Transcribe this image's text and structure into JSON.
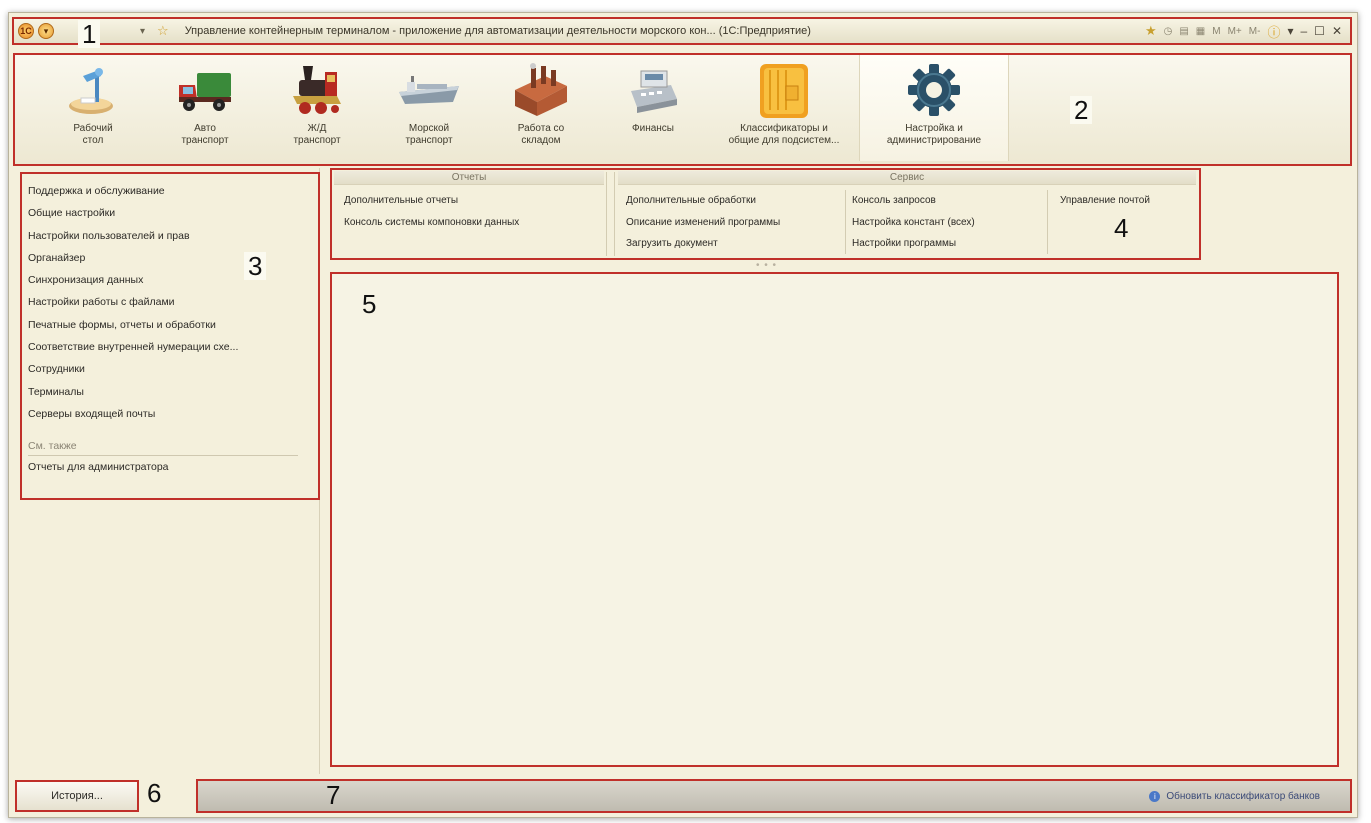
{
  "window": {
    "title": "Управление контейнерным терминалом - приложение для автоматизации деятельности морского кон... (1С:Предприятие)",
    "logo_icon": "1c-logo-icon",
    "toolbar_right": [
      "M",
      "M+",
      "M-"
    ]
  },
  "callouts": [
    "1",
    "2",
    "3",
    "4",
    "5",
    "6",
    "7"
  ],
  "sections": [
    {
      "label": "Рабочий\nстол",
      "icon": "desk-lamp-icon"
    },
    {
      "label": "Авто\nтранспорт",
      "icon": "truck-icon"
    },
    {
      "label": "Ж/Д\nтранспорт",
      "icon": "locomotive-icon"
    },
    {
      "label": "Морской\nтранспорт",
      "icon": "ship-icon"
    },
    {
      "label": "Работа со\nскладом",
      "icon": "warehouse-icon"
    },
    {
      "label": "Финансы",
      "icon": "cash-register-icon"
    },
    {
      "label": "Классификаторы и\nобщие для подсистем...",
      "icon": "folder-icon"
    },
    {
      "label": "Настройка и\nадминистрирование",
      "icon": "gear-icon",
      "active": true
    }
  ],
  "leftnav": {
    "items": [
      "Поддержка и обслуживание",
      "Общие настройки",
      "Настройки пользователей и прав",
      "Органайзер",
      "Синхронизация данных",
      "Настройки работы с файлами",
      "Печатные формы, отчеты и обработки",
      "Соответствие внутренней нумерации схе...",
      "Сотрудники",
      "Терминалы",
      "Серверы входящей почты"
    ],
    "see_also_title": "См. также",
    "see_also_items": [
      "Отчеты для администратора"
    ]
  },
  "commands": {
    "reports_title": "Отчеты",
    "reports": [
      "Дополнительные отчеты",
      "Консоль системы компоновки данных"
    ],
    "service_title": "Сервис",
    "service_col1": [
      "Дополнительные обработки",
      "Описание изменений программы",
      "Загрузить документ"
    ],
    "service_col2": [
      "Консоль запросов",
      "Настройка констант (всех)",
      "Настройки программы"
    ],
    "service_col3": [
      "Управление почтой"
    ]
  },
  "footer": {
    "history_label": "История...",
    "status_link": "Обновить классификатор банков"
  },
  "colors": {
    "accent_border": "#c0302a",
    "background": "#f4f0dc"
  }
}
